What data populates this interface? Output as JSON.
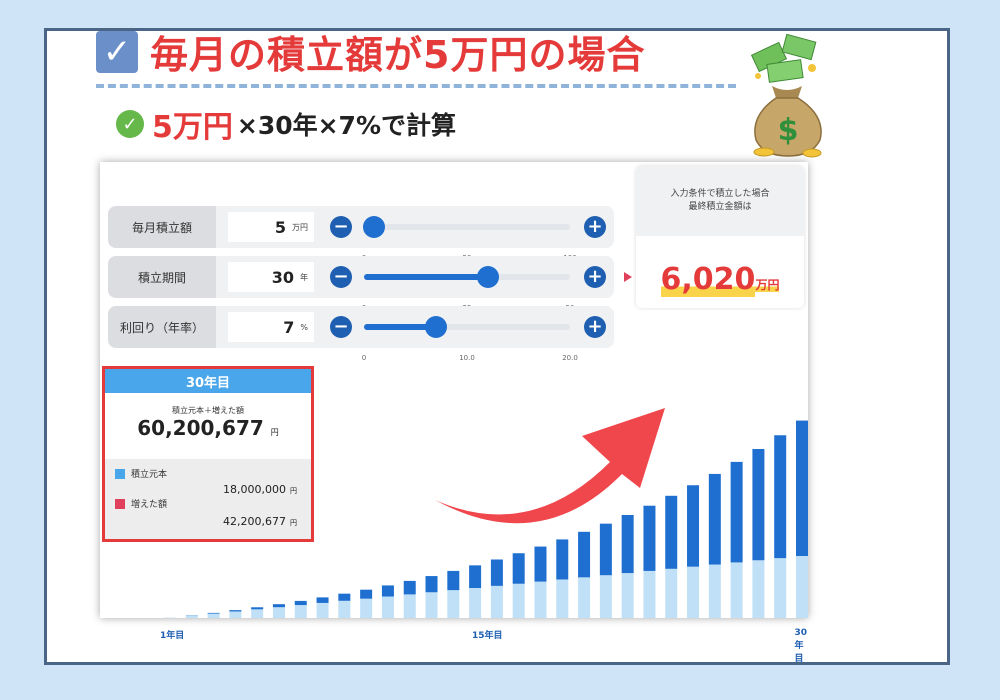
{
  "heading": {
    "checkbox_icon": "checkbox-check-icon",
    "title": "毎月の積立額が5万円の場合",
    "sub_check_icon": "check-circle-icon",
    "sub_red": "5万円",
    "sub_black": "×30年×7%で計算"
  },
  "decoration": {
    "bag_icon": "money-bag-dollar-icon"
  },
  "calculator": {
    "rows": [
      {
        "label": "毎月積立額",
        "value": "5",
        "unit": "万円",
        "ticks": [
          "0",
          "50",
          "100"
        ],
        "level": 0.05
      },
      {
        "label": "積立期間",
        "value": "30",
        "unit": "年",
        "ticks": [
          "0",
          "25",
          "50"
        ],
        "level": 0.6
      },
      {
        "label": "利回り（年率）",
        "value": "7",
        "unit": "%",
        "ticks": [
          "0",
          "10.0",
          "20.0"
        ],
        "level": 0.35
      }
    ],
    "minus_symbol": "−",
    "plus_symbol": "+",
    "result": {
      "line1": "入力条件で積立した場合",
      "line2": "最終積立金額は",
      "amount": "6,020",
      "unit": "万円"
    }
  },
  "info_card": {
    "header": "30年目",
    "caption": "積立元本＋増えた額",
    "total": "60,200,677",
    "total_unit": "円",
    "principal_label": "積立元本",
    "principal_value": "18,000,000",
    "gain_label": "増えた額",
    "gain_value": "42,200,677",
    "value_unit": "円"
  },
  "colors": {
    "accent_red": "#e53a3a",
    "bar_dark": "#1f6fd0",
    "bar_light": "#bfe0f7",
    "legend_principal": "#4aa6ea",
    "legend_gain": "#e0405a"
  },
  "chart_data": {
    "type": "bar",
    "stacked": true,
    "x_tick_labels": [
      "1年目",
      "15年目",
      "30年目"
    ],
    "categories": [
      1,
      2,
      3,
      4,
      5,
      6,
      7,
      8,
      9,
      10,
      11,
      12,
      13,
      14,
      15,
      16,
      17,
      18,
      19,
      20,
      21,
      22,
      23,
      24,
      25,
      26,
      27,
      28,
      29,
      30
    ],
    "series": [
      {
        "name": "積立元本",
        "color": "#bfe0f7",
        "values": [
          60,
          120,
          180,
          240,
          300,
          360,
          420,
          480,
          540,
          600,
          660,
          720,
          780,
          840,
          900,
          960,
          1020,
          1080,
          1140,
          1200,
          1260,
          1320,
          1380,
          1440,
          1500,
          1560,
          1620,
          1680,
          1740,
          1800
        ]
      },
      {
        "name": "増えた額",
        "color": "#1f6fd0",
        "values": [
          2,
          9,
          20,
          37,
          58,
          85,
          117,
          156,
          201,
          253,
          313,
          380,
          456,
          541,
          637,
          742,
          858,
          986,
          1127,
          1281,
          1450,
          1634,
          1835,
          2054,
          2291,
          2549,
          2828,
          3130,
          3457,
          3810
        ]
      }
    ],
    "ylim": [
      0,
      6020
    ],
    "grid": false,
    "legend": "none"
  }
}
